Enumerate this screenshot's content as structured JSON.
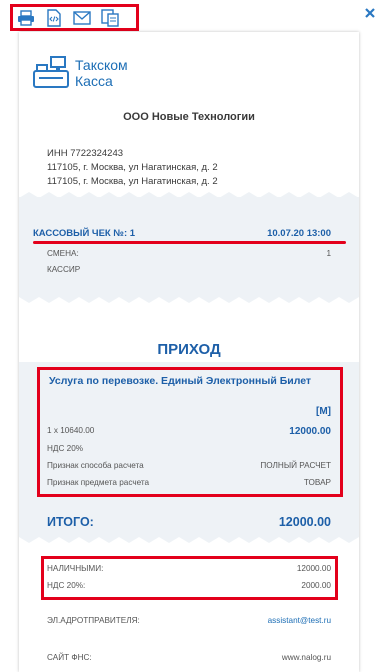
{
  "toolbar": {
    "icons": [
      "print-icon",
      "code-icon",
      "mail-icon",
      "copy-icon"
    ],
    "close_icon": "close-icon"
  },
  "logo": {
    "line1": "Такском",
    "line2": "Касса"
  },
  "org": {
    "name": "ООО Новые Технологии",
    "inn": "ИНН 7722324243",
    "address1": "117105, г. Москва, ул Нагатинская, д. 2",
    "address2": "117105, г. Москва, ул Нагатинская, д. 2"
  },
  "check": {
    "title": "КАССОВЫЙ ЧЕК №: 1",
    "datetime": "10.07.20 13:00",
    "shift_label": "СМЕНА:",
    "shift_value": "1",
    "cashier_label": "КАССИР"
  },
  "operation": "ПРИХОД",
  "item": {
    "name": "Услуга по перевозке. Единый Электронный Билет",
    "mark": "[М]",
    "qty_price": "1 x 10640.00",
    "sum": "12000.00",
    "vat": "НДС 20%",
    "method_label": "Признак способа расчета",
    "method_value": "ПОЛНЫЙ РАСЧЕТ",
    "subject_label": "Признак предмета расчета",
    "subject_value": "ТОВАР"
  },
  "total": {
    "label": "ИТОГО:",
    "value": "12000.00"
  },
  "payments": {
    "cash_label": "НАЛИЧНЫМИ:",
    "cash_value": "12000.00",
    "vat_label": "НДС 20%:",
    "vat_value": "2000.00"
  },
  "footer": {
    "email_label": "ЭЛ.АДРОТПРАВИТЕЛЯ:",
    "email_value": "assistant@test.ru",
    "fns_label": "САЙТ ФНС:",
    "fns_value": "www.nalog.ru"
  },
  "colors": {
    "accent": "#1d5fa8",
    "highlight": "#e3001b",
    "paper_tint": "#eef2f6"
  }
}
